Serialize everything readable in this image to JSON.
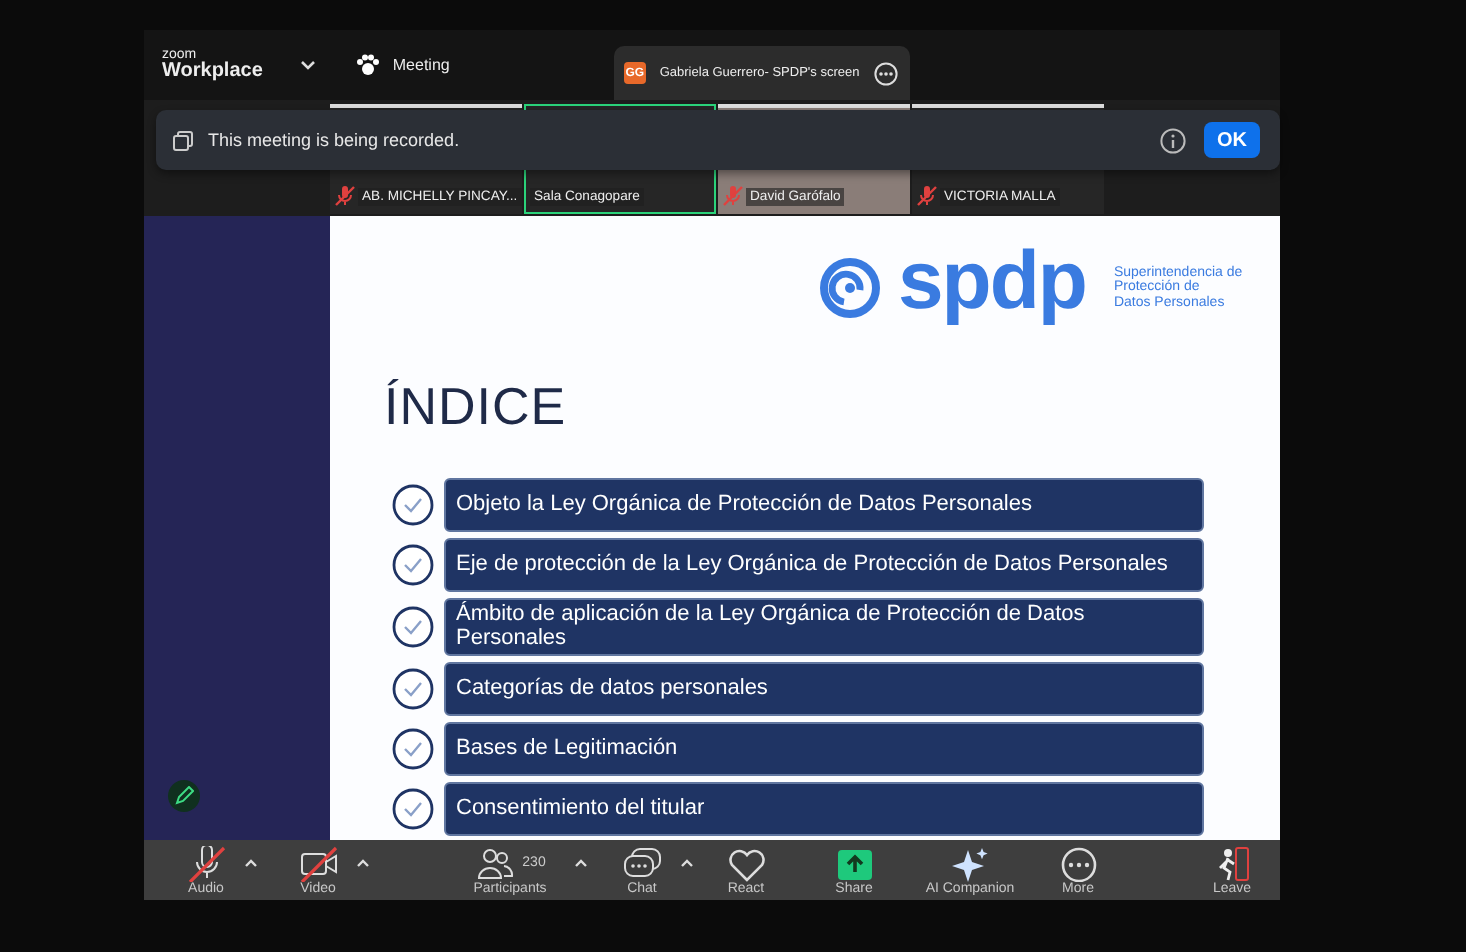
{
  "app": {
    "logo_top": "zoom",
    "logo_bottom": "Workplace"
  },
  "tabs": [
    {
      "label": "Meeting",
      "kind": "meeting"
    }
  ],
  "share_tab": {
    "initials": "GG",
    "label": "Gabriela Guerrero- SPDP's screen"
  },
  "banner": {
    "message": "This meeting is being recorded.",
    "button": "OK"
  },
  "participants": [
    {
      "name": "AB. MICHELLY PINCAY...",
      "muted": true,
      "active_speaker": false,
      "video": false
    },
    {
      "name": "Sala Conagopare",
      "muted": false,
      "active_speaker": true,
      "video": false
    },
    {
      "name": "David Garófalo",
      "muted": true,
      "active_speaker": false,
      "video": true
    },
    {
      "name": "VICTORIA MALLA",
      "muted": true,
      "active_speaker": false,
      "video": false
    }
  ],
  "slide": {
    "logo": "spdp",
    "tagline": [
      "Superintendencia de",
      "Protección de",
      "Datos Personales"
    ],
    "title": "ÍNDICE",
    "items": [
      {
        "text": "Objeto la Ley Orgánica de Protección de Datos Personales",
        "checked": true
      },
      {
        "text": "Eje de protección de la Ley Orgánica de Protección de Datos Personales",
        "checked": true
      },
      {
        "text": "Ámbito de aplicación de la Ley Orgánica de Protección de Datos Personales",
        "checked": true
      },
      {
        "text": "Categorías de datos personales",
        "checked": true
      },
      {
        "text": "Bases de Legitimación",
        "checked": true
      },
      {
        "text": "Consentimiento del titular",
        "checked": true
      }
    ]
  },
  "toolbar": [
    {
      "kind": "audio",
      "label": "Audio",
      "off": true,
      "caret": true
    },
    {
      "kind": "video",
      "label": "Video",
      "off": true,
      "caret": true
    },
    {
      "kind": "participants",
      "label": "Participants",
      "count": "230",
      "caret": true
    },
    {
      "kind": "chat",
      "label": "Chat",
      "caret": true
    },
    {
      "kind": "react",
      "label": "React",
      "caret": false
    },
    {
      "kind": "share",
      "label": "Share",
      "caret": false
    },
    {
      "kind": "ai",
      "label": "AI Companion",
      "caret": false
    },
    {
      "kind": "more",
      "label": "More",
      "caret": false
    },
    {
      "kind": "leave",
      "label": "Leave",
      "caret": false
    }
  ]
}
